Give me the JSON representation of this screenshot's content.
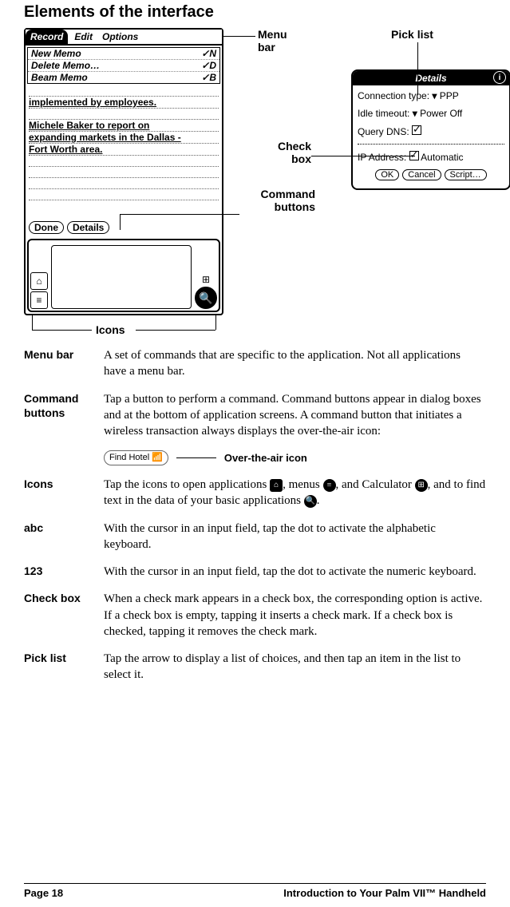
{
  "heading": "Elements of the interface",
  "callouts": {
    "menu_bar": "Menu\nbar",
    "pick_list": "Pick list",
    "check_box": "Check\nbox",
    "command_buttons": "Command\nbuttons",
    "icons": "Icons"
  },
  "palm": {
    "menu_active": "Record",
    "menu_item_edit": "Edit",
    "menu_item_options": "Options",
    "dd_new": "New Memo",
    "dd_new_sc": "✓N",
    "dd_delete": "Delete Memo…",
    "dd_delete_sc": "✓D",
    "dd_beam": "Beam Memo",
    "dd_beam_sc": "✓B",
    "memo1": "implemented by employees.",
    "memo2a": "Michele Baker to report on",
    "memo2b": "expanding markets in the Dallas -",
    "memo2c": "Fort Worth area.",
    "btn_done": "Done",
    "btn_details": "Details"
  },
  "details": {
    "title": "Details",
    "conn_label": "Connection type:",
    "conn_value": "PPP",
    "idle_label": "Idle timeout:",
    "idle_value": "Power Off",
    "query_label": "Query DNS:",
    "ip_label": "IP Address:",
    "ip_value": "Automatic",
    "btn_ok": "OK",
    "btn_cancel": "Cancel",
    "btn_script": "Script…"
  },
  "ota": {
    "button_label": "Find Hotel",
    "callout": "Over-the-air icon"
  },
  "defs": {
    "menu_bar": {
      "term": "Menu bar",
      "desc": "A set of commands that are specific to the application. Not all applications have a menu bar."
    },
    "command_buttons": {
      "term": "Command buttons",
      "desc": "Tap a button to perform a command. Command buttons appear in dialog boxes and at the bottom of application screens. A command button that initiates a wireless transaction always displays the over-the-air icon:"
    },
    "icons": {
      "term": "Icons",
      "desc_a": "Tap the icons to open applications ",
      "desc_b": ", menus ",
      "desc_c": ", and Calculator ",
      "desc_d": ", and to find text in the data of your basic applications ",
      "desc_e": "."
    },
    "abc": {
      "term": "abc",
      "desc": "With the cursor in an input field, tap the dot to activate the alphabetic keyboard."
    },
    "n123": {
      "term": "123",
      "desc": "With the cursor in an input field, tap the dot to activate the numeric keyboard."
    },
    "check_box": {
      "term": "Check box",
      "desc": "When a check mark appears in a check box, the corresponding option is active. If a check box is empty, tapping it inserts a check mark. If a check box is checked, tapping it removes the check mark."
    },
    "pick_list": {
      "term": "Pick list",
      "desc": "Tap the arrow to display a list of choices, and then tap an item in the list to select it."
    }
  },
  "footer": {
    "page": "Page 18",
    "book": "Introduction to Your Palm VII™ Handheld"
  }
}
